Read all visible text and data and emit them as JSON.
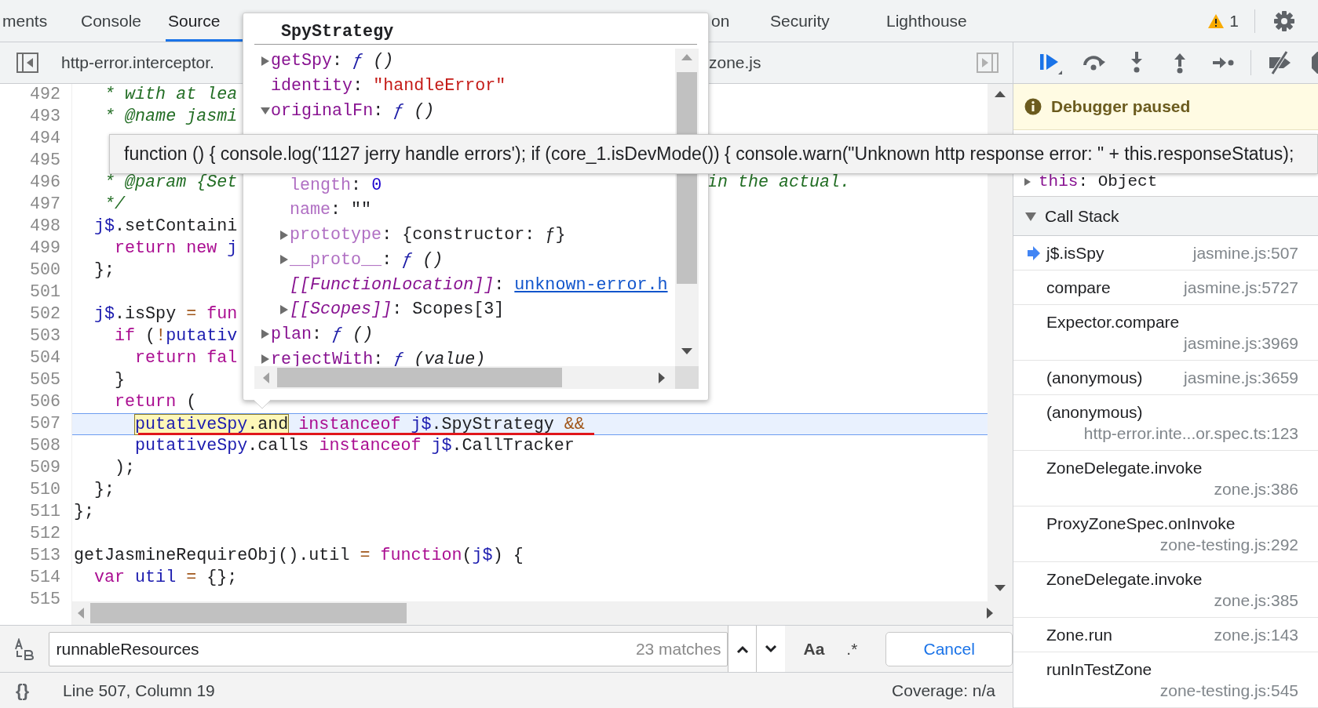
{
  "top_tabs": [
    {
      "label": "ments",
      "selected": false
    },
    {
      "label": "Console",
      "selected": false
    },
    {
      "label": "Source",
      "selected": true
    },
    {
      "label": "on",
      "selected": false
    },
    {
      "label": "Security",
      "selected": false
    },
    {
      "label": "Lighthouse",
      "selected": false
    }
  ],
  "warning_count": "1",
  "file_tabs": [
    {
      "label": "http-error.interceptor."
    },
    {
      "label": "zone.js"
    }
  ],
  "editor": {
    "lines": [
      {
        "number": "492",
        "tokens": [
          {
            "text": "   * with at lea",
            "kind": "comment"
          }
        ]
      },
      {
        "number": "493",
        "tokens": [
          {
            "text": "   * @name jasmi",
            "kind": "comment"
          }
        ]
      },
      {
        "number": "494"
      },
      {
        "number": "495"
      },
      {
        "number": "496",
        "tokens": [
          {
            "text": "   * @param {Set",
            "kind": "comment"
          }
        ],
        "tail": [
          {
            "text": "in the actual.",
            "kind": "comment"
          }
        ]
      },
      {
        "number": "497",
        "tokens": [
          {
            "text": "   */",
            "kind": "comment"
          }
        ]
      },
      {
        "number": "498",
        "tokens": [
          {
            "text": "  j$",
            "kind": "variable"
          },
          {
            "text": ".setContaini",
            "kind": "plain"
          }
        ]
      },
      {
        "number": "499",
        "tokens": [
          {
            "text": "    return new ",
            "kind": "keyword"
          },
          {
            "text": "j",
            "kind": "variable"
          }
        ]
      },
      {
        "number": "500",
        "tokens": [
          {
            "text": "  };",
            "kind": "plain"
          }
        ]
      },
      {
        "number": "501"
      },
      {
        "number": "502",
        "tokens": [
          {
            "text": "  j$",
            "kind": "variable"
          },
          {
            "text": ".isSpy ",
            "kind": "plain"
          },
          {
            "text": "= ",
            "kind": "operator"
          },
          {
            "text": "fun",
            "kind": "keyword"
          }
        ]
      },
      {
        "number": "503",
        "tokens": [
          {
            "text": "    if ",
            "kind": "keyword"
          },
          {
            "text": "(",
            "kind": "plain"
          },
          {
            "text": "!",
            "kind": "operator"
          },
          {
            "text": "putativ",
            "kind": "variable"
          }
        ]
      },
      {
        "number": "504",
        "tokens": [
          {
            "text": "      return fal",
            "kind": "keyword"
          }
        ]
      },
      {
        "number": "505",
        "tokens": [
          {
            "text": "    }",
            "kind": "plain"
          }
        ]
      },
      {
        "number": "506",
        "tokens": [
          {
            "text": "    return ",
            "kind": "keyword"
          },
          {
            "text": "(",
            "kind": "plain"
          }
        ]
      },
      {
        "number": "507",
        "current": true,
        "underlined": true,
        "tokens": [
          {
            "text": "      putativeSpy",
            "kind": "variable",
            "boxed": true
          },
          {
            "text": ".and",
            "kind": "plain",
            "boxed": true
          },
          {
            "text": " instanceof ",
            "kind": "keyword"
          },
          {
            "text": "j$",
            "kind": "variable"
          },
          {
            "text": ".SpyStrategy ",
            "kind": "plain"
          },
          {
            "text": "&&",
            "kind": "operator"
          }
        ]
      },
      {
        "number": "508",
        "tokens": [
          {
            "text": "      putativeSpy",
            "kind": "variable"
          },
          {
            "text": ".calls ",
            "kind": "plain"
          },
          {
            "text": "instanceof ",
            "kind": "keyword"
          },
          {
            "text": "j$",
            "kind": "variable"
          },
          {
            "text": ".CallTracker",
            "kind": "plain"
          }
        ]
      },
      {
        "number": "509",
        "tokens": [
          {
            "text": "    );",
            "kind": "plain"
          }
        ]
      },
      {
        "number": "510",
        "tokens": [
          {
            "text": "  };",
            "kind": "plain"
          }
        ]
      },
      {
        "number": "511",
        "tokens": [
          {
            "text": "};",
            "kind": "plain"
          }
        ]
      },
      {
        "number": "512"
      },
      {
        "number": "513",
        "tokens": [
          {
            "text": "getJasmineRequireObj().util ",
            "kind": "plain"
          },
          {
            "text": "= ",
            "kind": "operator"
          },
          {
            "text": "function",
            "kind": "keyword"
          },
          {
            "text": "(",
            "kind": "plain"
          },
          {
            "text": "j$",
            "kind": "variable"
          },
          {
            "text": ") {",
            "kind": "plain"
          }
        ]
      },
      {
        "number": "514",
        "tokens": [
          {
            "text": "  var ",
            "kind": "keyword"
          },
          {
            "text": "util ",
            "kind": "variable"
          },
          {
            "text": "= ",
            "kind": "operator"
          },
          {
            "text": "{};",
            "kind": "plain"
          }
        ]
      },
      {
        "number": "515"
      }
    ]
  },
  "popup": {
    "title": "SpyStrategy",
    "items": [
      {
        "key": "getSpy:",
        "dimmed": false,
        "internal": false,
        "value": "ƒ ()",
        "kind": "function",
        "expanded": false
      },
      {
        "key": "identity:",
        "dimmed": false,
        "internal": false,
        "value": "\"handleError\"",
        "kind": "string"
      },
      {
        "key": "originalFn:",
        "dimmed": false,
        "internal": false,
        "value": "ƒ ()",
        "kind": "function",
        "expanded": true,
        "children": [
          {
            "key": "length:",
            "dimmed": true,
            "internal": false,
            "value": "0",
            "kind": "number"
          },
          {
            "key": "name:",
            "dimmed": true,
            "internal": false,
            "value": "\"\"",
            "kind": "plain"
          },
          {
            "key": "prototype:",
            "dimmed": true,
            "internal": false,
            "value": "{constructor: ƒ}",
            "kind": "plain",
            "expanded": false
          },
          {
            "key": "__proto__:",
            "dimmed": true,
            "internal": false,
            "value": "ƒ ()",
            "kind": "function",
            "expanded": false
          },
          {
            "key": "[[FunctionLocation]]:",
            "dimmed": false,
            "internal": true,
            "value": "unknown-error.h",
            "kind": "link"
          },
          {
            "key": "[[Scopes]]:",
            "dimmed": false,
            "internal": true,
            "value": "Scopes[3]",
            "kind": "plain",
            "expanded": false
          }
        ]
      },
      {
        "key": "plan:",
        "dimmed": false,
        "internal": false,
        "value": "ƒ ()",
        "kind": "function",
        "expanded": false
      },
      {
        "key": "rejectWith:",
        "dimmed": false,
        "internal": false,
        "value": "ƒ (value)",
        "kind": "function",
        "expanded": false
      }
    ]
  },
  "tooltip": "function () { console.log('1127 jerry handle errors'); if (core_1.isDevMode()) { console.warn(\"Unknown http response error: \" + this.responseStatus);",
  "search": {
    "value": "runnableResources",
    "matches": "23 matches",
    "case_button": "Aa",
    "regex_button": ".*",
    "cancel": "Cancel"
  },
  "status": {
    "format_button": "{}",
    "position": "Line 507, Column 19",
    "coverage": "Coverage: n/a"
  },
  "debugger": {
    "banner": "Debugger paused",
    "scope_rows": [
      {
        "key": "this:",
        "value": "Object",
        "expanded": false
      }
    ],
    "call_stack": {
      "title": "Call Stack",
      "expanded": true,
      "frames": [
        {
          "name": "j$.isSpy",
          "location": "jasmine.js:507",
          "selected": true
        },
        {
          "name": "compare",
          "location": "jasmine.js:5727",
          "selected": false
        },
        {
          "name": "Expector.compare",
          "location": "jasmine.js:3969",
          "selected": false
        },
        {
          "name": "(anonymous)",
          "location": "jasmine.js:3659",
          "selected": false
        },
        {
          "name": "(anonymous)",
          "location": "http-error.inte...or.spec.ts:123",
          "selected": false
        },
        {
          "name": "ZoneDelegate.invoke",
          "location": "zone.js:386",
          "selected": false
        },
        {
          "name": "ProxyZoneSpec.onInvoke",
          "location": "zone-testing.js:292",
          "selected": false
        },
        {
          "name": "ZoneDelegate.invoke",
          "location": "zone.js:385",
          "selected": false
        },
        {
          "name": "Zone.run",
          "location": "zone.js:143",
          "selected": false
        },
        {
          "name": "runInTestZone",
          "location": "zone-testing.js:545",
          "selected": false
        }
      ]
    }
  }
}
